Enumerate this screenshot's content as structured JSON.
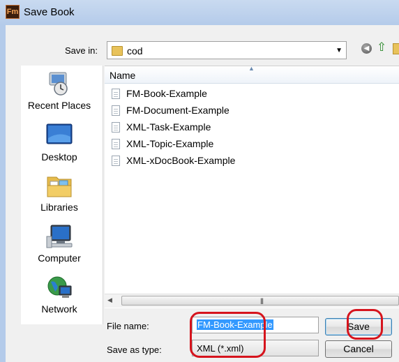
{
  "window": {
    "app_icon_text": "Fm",
    "title": "Save Book"
  },
  "toolbar": {
    "save_in_label": "Save in:",
    "location": "cod",
    "icons": [
      "back-icon",
      "up-folder-icon",
      "new-folder-icon"
    ]
  },
  "places": [
    {
      "label": "Recent Places",
      "icon": "recent-places-icon"
    },
    {
      "label": "Desktop",
      "icon": "desktop-icon"
    },
    {
      "label": "Libraries",
      "icon": "libraries-icon"
    },
    {
      "label": "Computer",
      "icon": "computer-icon"
    },
    {
      "label": "Network",
      "icon": "network-icon"
    }
  ],
  "file_list": {
    "column_header": "Name",
    "files": [
      "FM-Book-Example",
      "FM-Document-Example",
      "XML-Task-Example",
      "XML-Topic-Example",
      "XML-xDocBook-Example"
    ]
  },
  "form": {
    "file_name_label": "File name:",
    "file_name_value": "FM-Book-Example",
    "save_as_type_label": "Save as type:",
    "save_as_type_value": "XML (*.xml)"
  },
  "buttons": {
    "save": "Save",
    "cancel": "Cancel"
  },
  "colors": {
    "selection": "#3399ff",
    "annotation": "#d6141d"
  }
}
